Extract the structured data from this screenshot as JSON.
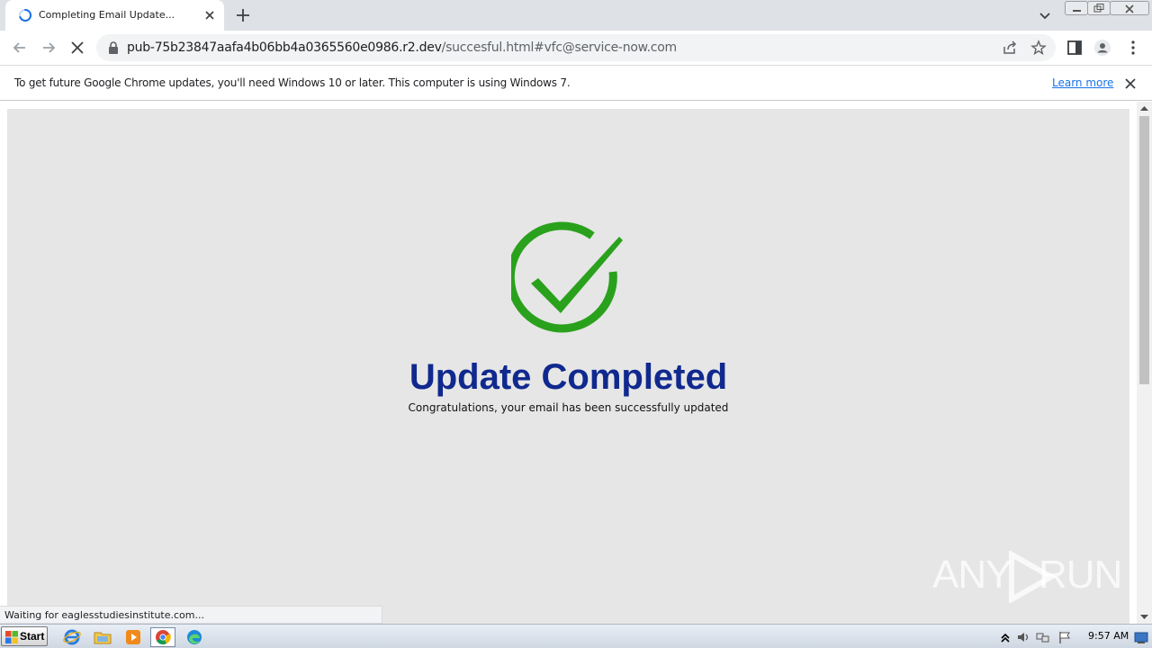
{
  "browser": {
    "tab": {
      "title": "Completing Email Update...",
      "icon": "loading-spinner-icon"
    },
    "address": {
      "host": "pub-75b23847aafa4b06bb4a0365560e0986.r2.dev",
      "path": "/succesful.html#vfc@service-now.com"
    },
    "infobar": {
      "message": "To get future Google Chrome updates, you'll need Windows 10 or later. This computer is using Windows 7.",
      "link": "Learn more"
    },
    "status": "Waiting for eaglesstudiesinstitute.com..."
  },
  "page": {
    "heading": "Update Completed",
    "message": "Congratulations, your email has been successfully updated",
    "icon": "check-circle-icon",
    "accent_color": "#2aa11c",
    "heading_color": "#10298e"
  },
  "watermark": {
    "left": "ANY",
    "right": "RUN"
  },
  "taskbar": {
    "start_label": "Start",
    "clock": "9:57 AM",
    "pinned": [
      "ie-icon",
      "folder-icon",
      "media-player-icon",
      "chrome-icon",
      "edge-icon"
    ]
  }
}
